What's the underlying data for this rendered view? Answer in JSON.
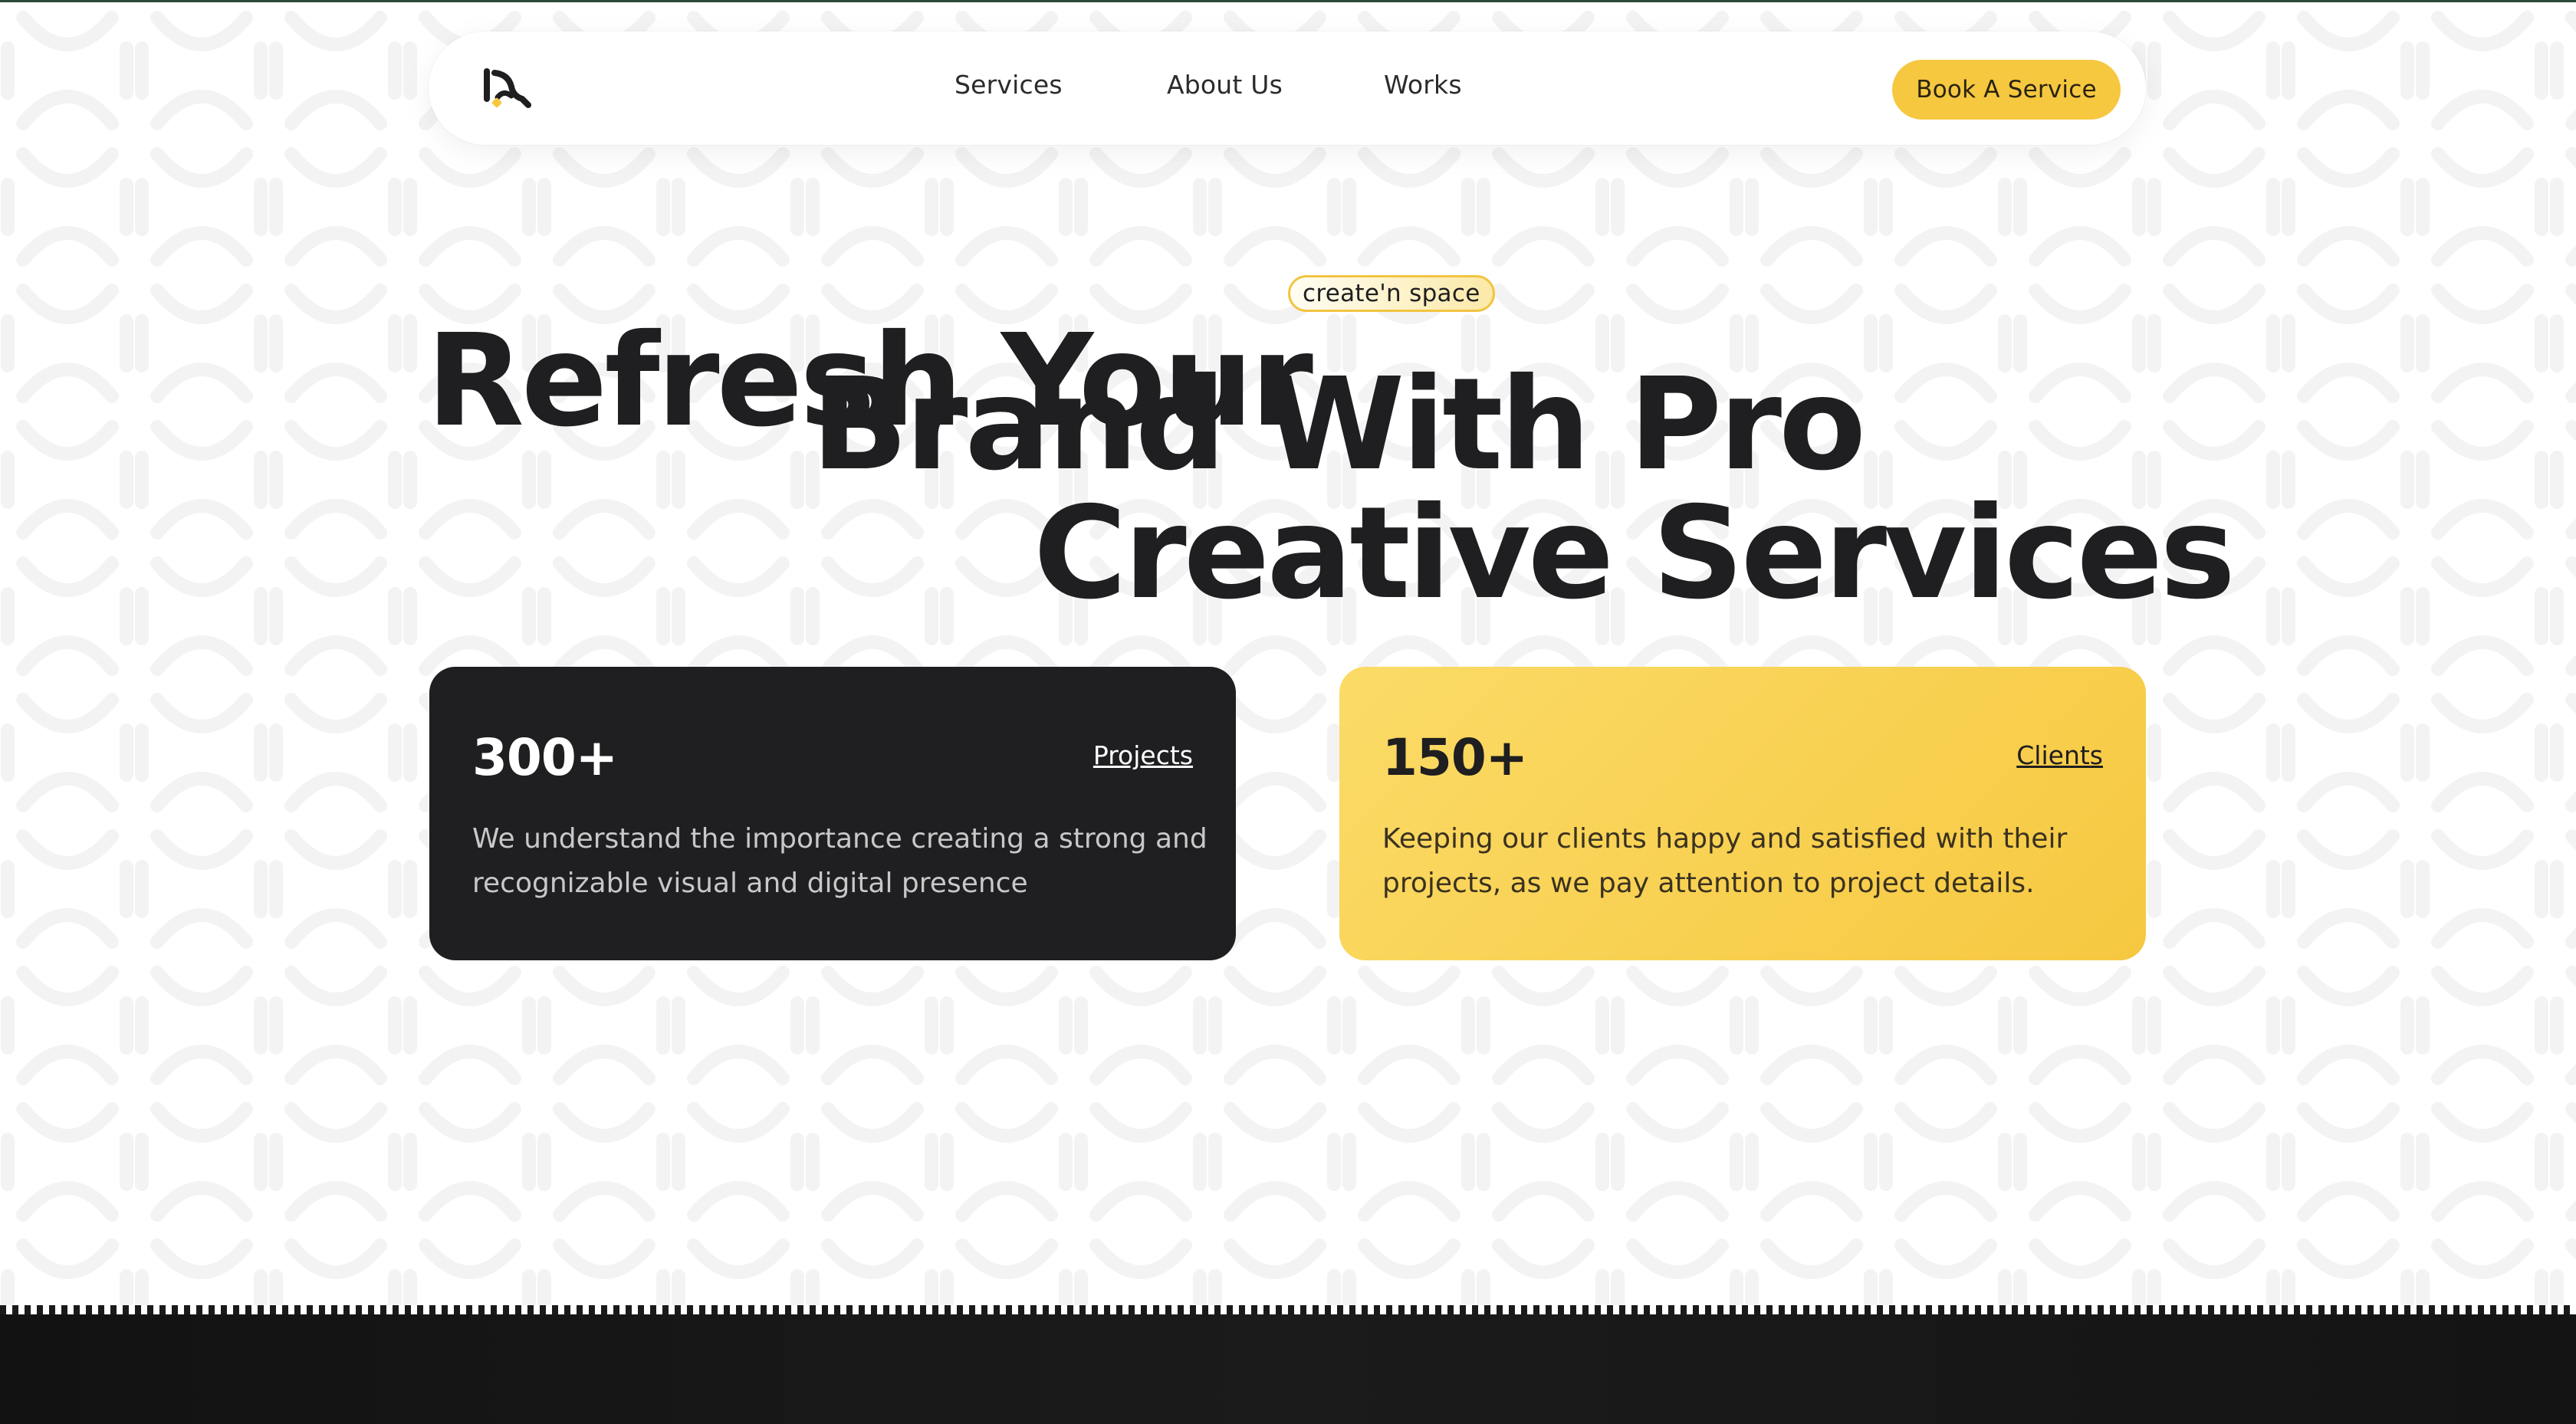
{
  "nav": {
    "links": [
      "Services",
      "About Us",
      "Works"
    ],
    "cta": "Book A Service",
    "logo_icon": "brand-logo-icon"
  },
  "hero": {
    "line1": "Refresh Your",
    "line2": "Brand With Pro",
    "line3": "Creative Services",
    "tag": "create'n space"
  },
  "stats": [
    {
      "number": "300+",
      "link": "Projects",
      "text": "We understand the importance creating a strong and recognizable visual and digital presence"
    },
    {
      "number": "150+",
      "link": "Clients",
      "text": "Keeping our clients happy and satisfied with their projects, as we pay attention to project details."
    }
  ],
  "colors": {
    "accent": "#f6c840",
    "dark": "#1f1e20",
    "background": "#ffffff"
  }
}
